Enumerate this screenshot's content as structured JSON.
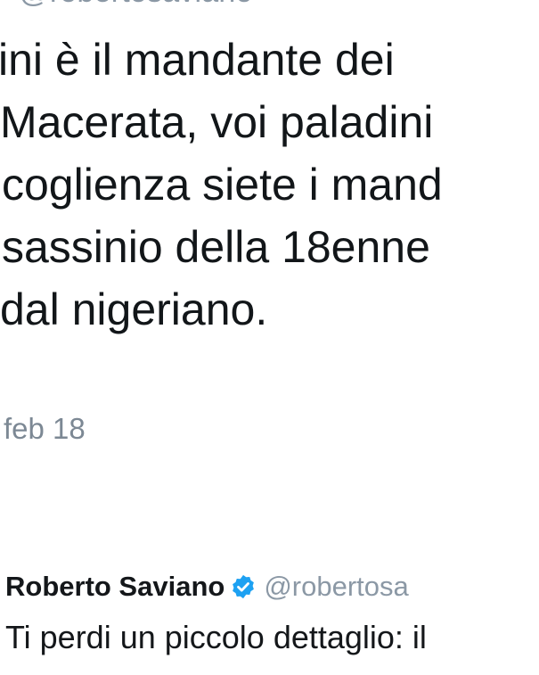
{
  "tweet1": {
    "handle_partial": "· @robertosaviano",
    "lines": [
      "ini è il mandante dei",
      "Macerata, voi paladini",
      "coglienza siete i mand",
      "sassinio della 18enne",
      "dal nigeriano."
    ],
    "date": "feb 18"
  },
  "tweet2": {
    "author_name": "Roberto Saviano",
    "verified_icon": "verified-badge-icon",
    "handle": "@robertosa",
    "text": "Ti perdi un piccolo dettaglio: il"
  },
  "colors": {
    "verified": "#1da1f2",
    "muted": "#8b98a5",
    "text": "#14171a"
  }
}
